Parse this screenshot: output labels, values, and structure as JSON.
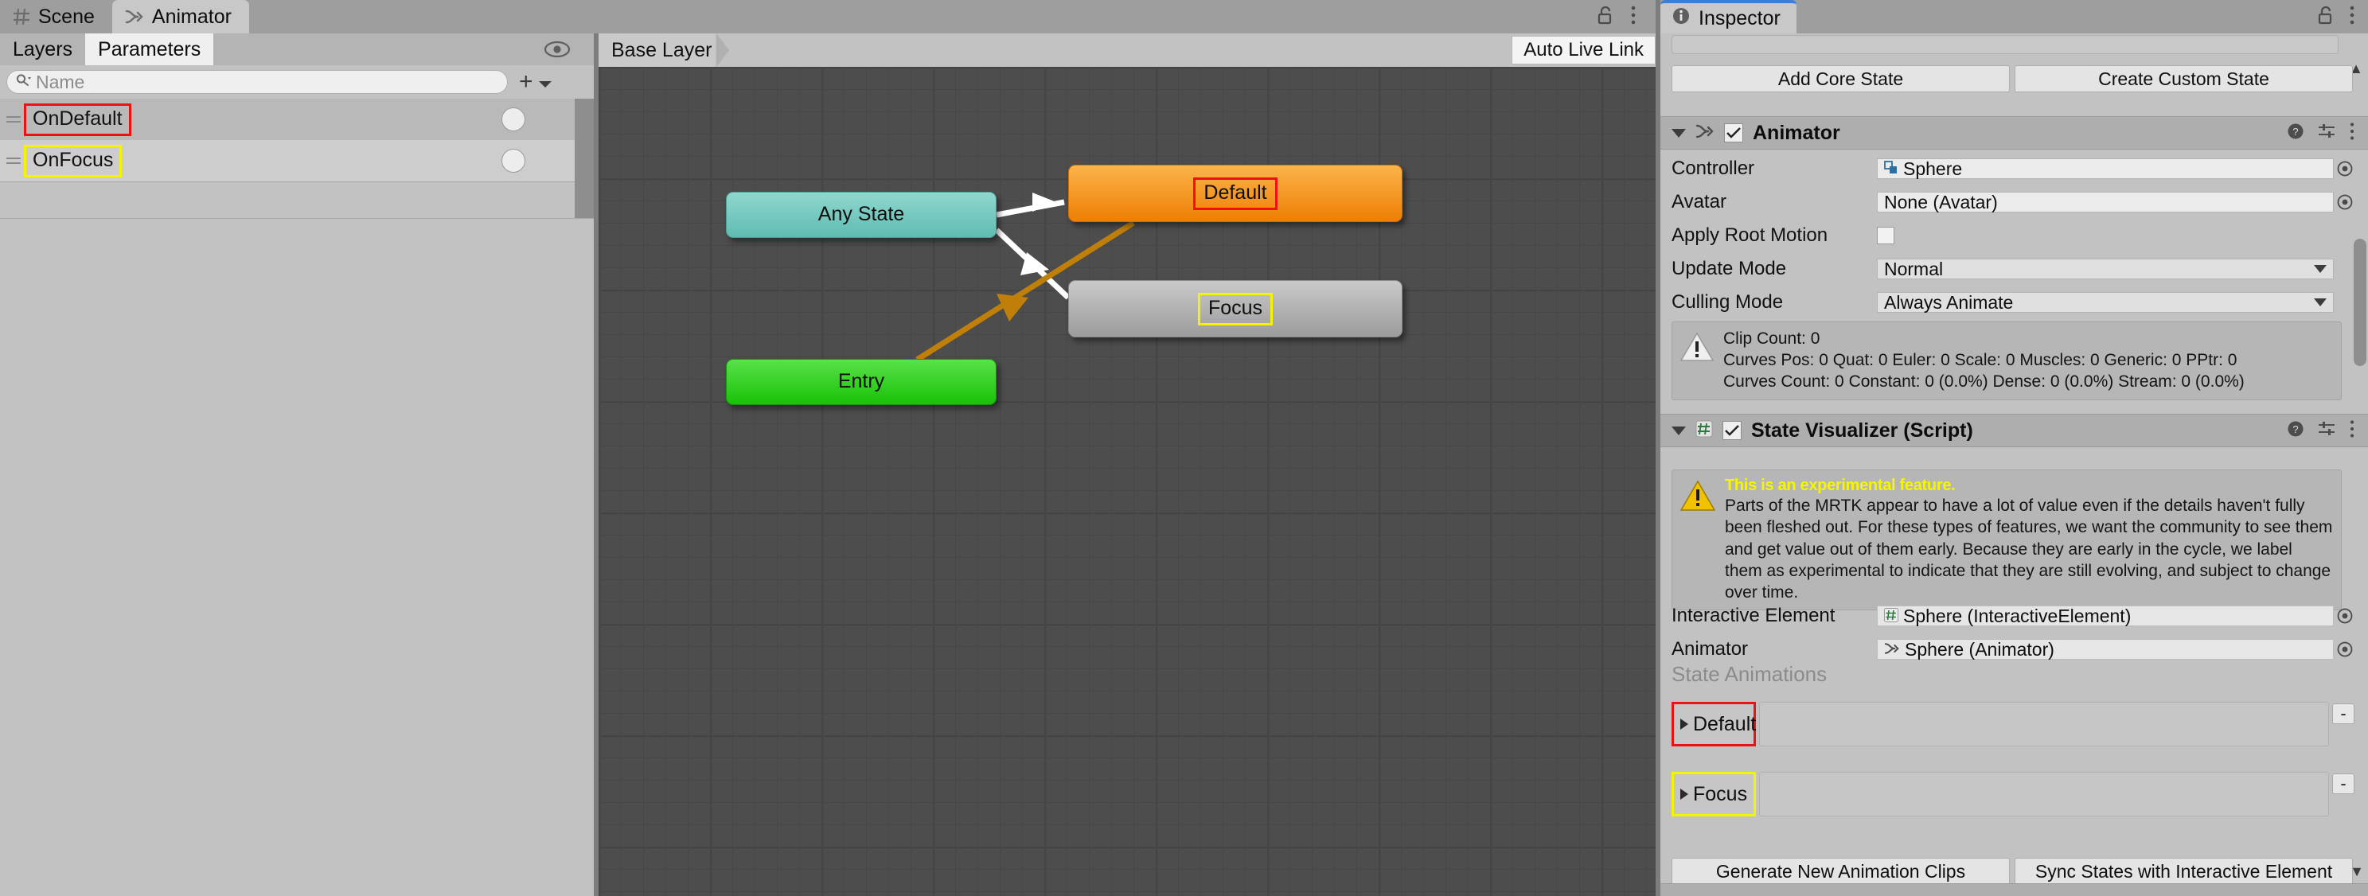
{
  "window": {
    "tabs": [
      {
        "label": "Scene",
        "icon": "grid-icon",
        "active": false
      },
      {
        "label": "Animator",
        "icon": "animator-icon",
        "active": true
      }
    ],
    "lock_icon": "lock-open-icon",
    "menu_icon": "kebab-menu-icon"
  },
  "animator_panel": {
    "subtabs": [
      {
        "label": "Layers",
        "active": false
      },
      {
        "label": "Parameters",
        "active": true
      }
    ],
    "eye_icon": "eye-icon",
    "search": {
      "value": "",
      "placeholder": "Name",
      "icon": "search-icon"
    },
    "add_button": {
      "label": "+",
      "caret": "chevron-down-icon"
    },
    "parameters": [
      {
        "name": "OnDefault",
        "highlight": "#ee1111",
        "toggle": false
      },
      {
        "name": "OnFocus",
        "highlight": "#f4f400",
        "toggle": false
      }
    ]
  },
  "graph": {
    "breadcrumb": "Base Layer",
    "auto_live_link": "Auto Live Link",
    "nodes": [
      {
        "id": "any-state",
        "label": "Any State",
        "color": "#6fc6bc",
        "highlight": "none"
      },
      {
        "id": "entry",
        "label": "Entry",
        "color": "#2ccb17",
        "highlight": "none"
      },
      {
        "id": "default",
        "label": "Default",
        "color": "#f4900f",
        "highlight": "#ee1111"
      },
      {
        "id": "focus",
        "label": "Focus",
        "color": "#aaaaaa",
        "highlight": "#f4f400"
      }
    ],
    "transitions": [
      {
        "from": "any-state",
        "to": "default",
        "color": "#ffffff"
      },
      {
        "from": "any-state",
        "to": "focus",
        "color": "#ffffff"
      },
      {
        "from": "entry",
        "to": "default",
        "color": "#c07f08"
      }
    ]
  },
  "inspector": {
    "tab": {
      "label": "Inspector",
      "icon": "info-icon"
    },
    "lock_icon": "lock-open-icon",
    "menu_icon": "kebab-menu-icon",
    "top_buttons": [
      {
        "label": "Add Core State"
      },
      {
        "label": "Create Custom State"
      }
    ],
    "animator_component": {
      "title": "Animator",
      "enabled": true,
      "help_icon": "help-icon",
      "preset_icon": "preset-icon",
      "menu_icon": "kebab-menu-icon",
      "fields": [
        {
          "label": "Controller",
          "value": "Sphere",
          "type": "object",
          "icon": "controller-asset-icon"
        },
        {
          "label": "Avatar",
          "value": "None (Avatar)",
          "type": "object",
          "icon": "none"
        },
        {
          "label": "Apply Root Motion",
          "value": "",
          "type": "checkbox",
          "checked": false
        },
        {
          "label": "Update Mode",
          "value": "Normal",
          "type": "dropdown"
        },
        {
          "label": "Culling Mode",
          "value": "Always Animate",
          "type": "dropdown"
        }
      ],
      "info": {
        "icon": "warning-icon",
        "lines": [
          "Clip Count: 0",
          "Curves Pos: 0 Quat: 0 Euler: 0 Scale: 0 Muscles: 0 Generic: 0 PPtr: 0",
          "Curves Count: 0 Constant: 0 (0.0%) Dense: 0 (0.0%) Stream: 0 (0.0%)"
        ]
      }
    },
    "state_visualizer": {
      "title": "State Visualizer (Script)",
      "enabled": true,
      "script_icon": "script-icon",
      "help_icon": "help-icon",
      "preset_icon": "preset-icon",
      "menu_icon": "kebab-menu-icon",
      "warning": {
        "icon": "warning-icon",
        "headline": "This is an experimental feature.",
        "body": "Parts of the MRTK appear to have a lot of value even if the details haven't fully been fleshed out. For these types of features, we want the community to see them and get value out of them early. Because they are early in the cycle, we label them as experimental to indicate that they are still evolving, and subject to change over time."
      },
      "fields": [
        {
          "label": "Interactive Element",
          "value": "Sphere (InteractiveElement)",
          "icon": "script-icon"
        },
        {
          "label": "Animator",
          "value": "Sphere (Animator)",
          "icon": "animator-icon"
        }
      ],
      "state_animations_title": "State Animations",
      "state_animations": [
        {
          "name": "Default",
          "highlight": "#ee1111",
          "remove_label": "-",
          "expander": "chevron-right-icon"
        },
        {
          "name": "Focus",
          "highlight": "#f4f400",
          "remove_label": "-",
          "expander": "chevron-right-icon"
        }
      ],
      "footer_buttons": [
        {
          "label": "Generate New Animation Clips"
        },
        {
          "label": "Sync States with Interactive Element"
        }
      ]
    }
  }
}
